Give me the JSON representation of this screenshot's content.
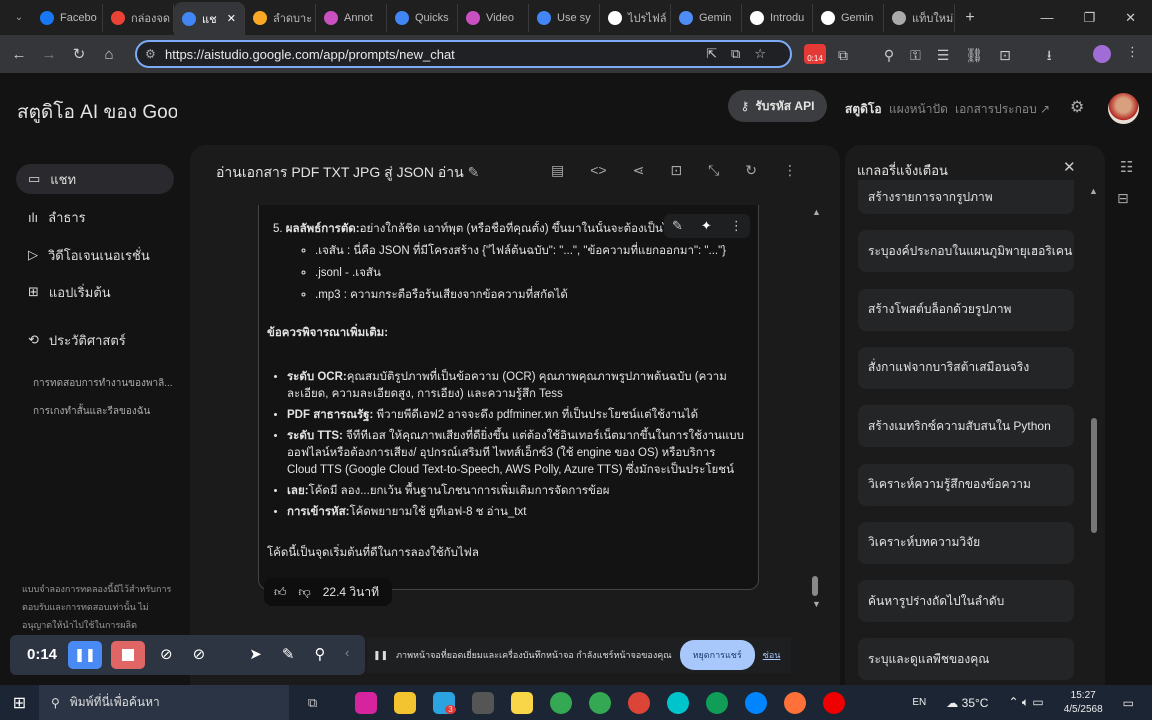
{
  "browser": {
    "tabs": [
      {
        "label": "Facebo",
        "color": "#1877f2"
      },
      {
        "label": "กล่องจด",
        "color": "#ea4335"
      },
      {
        "label": "แช",
        "color": "#4285f4",
        "active": true
      },
      {
        "label": "ลำดบาะ",
        "color": "#f9a825"
      },
      {
        "label": "Annot",
        "color": "#c850c0"
      },
      {
        "label": "Quicks",
        "color": "#4285f4"
      },
      {
        "label": "Video",
        "color": "#c850c0"
      },
      {
        "label": "Use sy",
        "color": "#4285f4"
      },
      {
        "label": "ไปรไฟล์",
        "color": "#ffffff"
      },
      {
        "label": "Gemin",
        "color": "#4e8df5"
      },
      {
        "label": "Introdu",
        "color": "#ffffff"
      },
      {
        "label": "Gemin",
        "color": "#ffffff"
      },
      {
        "label": "แท็บใหม่",
        "color": "#aaaaaa"
      }
    ],
    "url": "https://aistudio.google.com/app/prompts/new_chat",
    "ext_badge": "0:14"
  },
  "header": {
    "title": "สตูดิโอ AI ของ Goog",
    "api_button": "รับรหัส API",
    "nav": [
      "สตูดิโอ",
      "แผงหน้าปัด",
      "เอกสารประกอบ"
    ]
  },
  "sidebar": {
    "items": [
      {
        "label": "แชท",
        "icon": "chat-icon"
      },
      {
        "label": "ลำธาร",
        "icon": "stream-icon"
      },
      {
        "label": "วิดีโอเจนเนอเรชั่น",
        "icon": "video-icon"
      },
      {
        "label": "แอปเริ่มต้น",
        "icon": "apps-icon"
      },
      {
        "label": "ประวัติศาสตร์",
        "icon": "history-icon"
      }
    ],
    "history": [
      "การทดสอบการทำงานของพาลิ...",
      "การเกงทำสั้นและรีลของฉัน"
    ],
    "disclaimer": [
      "แบบจำลองการทดลองนี้มีไว้สำหรับการ",
      "ตอบรับและการทดสอบเท่านั้น ไม่",
      "อนุญาตให้นำไปใช้ในการผลิต"
    ]
  },
  "main": {
    "title": "อ่านเอกสาร PDF TXT JPG สู่ JSON อ่าน",
    "item5_bold": "ผลลัพธ์การตัด:",
    "item5_text": "อย่างใกล้ชิด เอาท์พุต (หรือชื่อที่คุณตั้ง) ขึ้นมาในนั้นจะต้องเป็นไฟเ",
    "sub": [
      ".เจสัน : นี่คือ JSON ที่มีโครงสร้าง {\"ไฟล์ต้นฉบับ\": \"...\", \"ข้อความที่แยกออกมา\": \"...\"}",
      ".jsonl - .เจสัน",
      ".mp3 : ความกระตือรือร้นเสียงจากข้อความที่สกัดได้"
    ],
    "considerations": "ข้อควรพิจารณาเพิ่มเติม:",
    "bullets": [
      {
        "bold": "ระดับ OCR:",
        "text": "คุณสมบัติรูปภาพที่เป็นข้อความ (OCR) คุณภาพคุณภาพรูปภาพต้นฉบับ (ความละเอียด, ความละเอียดสูง, การเอียง) และความรู้สึก Tess"
      },
      {
        "bold": "PDF สาธารณรัฐ:",
        "text": " พีวายพีดีเอฟ2 อาจจะดึง pdfminer.หก ที่เป็นประโยชน์แต่ใช้งานได้"
      },
      {
        "bold": "ระดับ TTS:",
        "text": " จีทีทีเอส ให้คุณภาพเสียงที่ดียิ่งขึ้น แต่ต้องใช้อินเทอร์เน็ตมากขึ้นในการใช้งานแบบออฟไลน์หรือต้องการเสียง/ อุปกรณ์เสริมที ไพทส์เอ็กซ์3 (ใช้ engine ของ OS) หรือบริการ Cloud TTS (Google Cloud Text-to-Speech, AWS Polly, Azure TTS) ซึ่งมักจะเป็นประโยชน์"
      },
      {
        "bold": "เลย:",
        "text": "โค้ดมี ลอง...ยกเว้น พื้นฐานโภชนาการเพิ่มเติมการจัดการข้อผ"
      },
      {
        "bold": "การเข้ารหัส:",
        "text": "โค้ดพยายามใช้ ยูทีเอฟ-8 ช อ่าน_txt"
      }
    ],
    "closing": "โค้ดนี้เป็นจุดเริ่มต้นที่ดีในการลองใช้กับไฟล",
    "duration": "22.4 วินาที"
  },
  "gallery": {
    "title": "แกลอรี่แจ้งเตือน",
    "items": [
      "สร้างรายการจากรูปภาพ",
      "ระบุองค์ประกอบในแผนภูมิพายุเฮอริเคน",
      "สร้างโพสต์บล็อกด้วยรูปภาพ",
      "สั่งกาแฟจากบาริสต้าเสมือนจริง",
      "สร้างเมทริกซ์ความสับสนใน Python",
      "วิเคราะห์ความรู้สึกของข้อความ",
      "วิเคราะห์บทความวิจัย",
      "ค้นหารูปร่างถัดไปในลำดับ",
      "ระบุและดูแลพืชของคุณ"
    ]
  },
  "recorder": {
    "time": "0:14",
    "message": "ภาพหน้าจอที่ยอดเยี่ยมและเครื่องบันทึกหน้าจอ กำลังแชร์หน้าจอของคุณ",
    "stop_share": "หยุดการแชร์",
    "hide": "ซ่อน"
  },
  "taskbar": {
    "search": "พิมพ์ที่นี่เพื่อค้นหา",
    "lang": "EN",
    "temp": "35°C",
    "time": "15:27",
    "date": "4/5/2568",
    "telegram_badge": "3"
  }
}
